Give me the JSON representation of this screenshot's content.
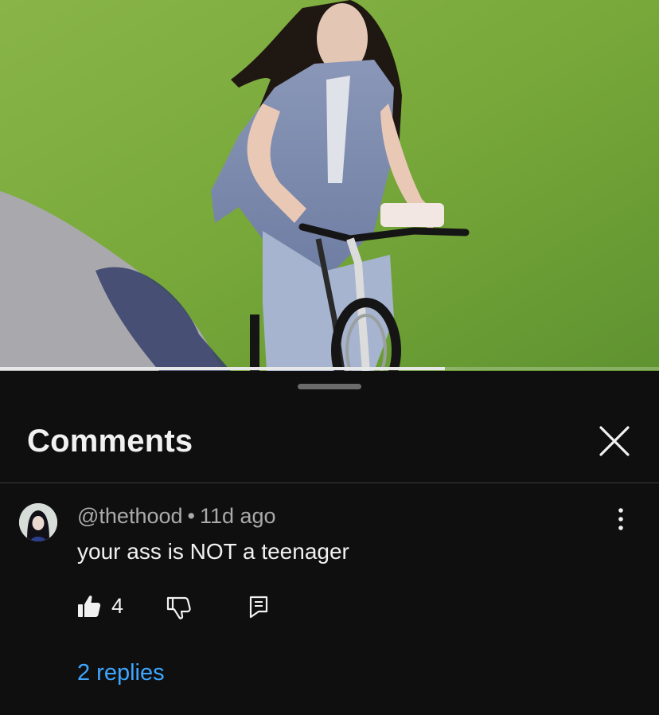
{
  "video": {
    "progress_fraction": 0.675
  },
  "comments_sheet": {
    "title": "Comments",
    "close_icon": "close-icon"
  },
  "comment": {
    "author": "@thethood",
    "separator": "•",
    "time": "11d ago",
    "text": "your ass is NOT a teenager",
    "like_count": "4",
    "replies_label": "2 replies",
    "icons": {
      "like": "thumbs-up-icon",
      "dislike": "thumbs-down-icon",
      "reply": "reply-icon",
      "more": "more-vertical-icon"
    }
  },
  "colors": {
    "background": "#0f0f0f",
    "text_primary": "#f1f1f1",
    "text_secondary": "#aaaaaa",
    "link": "#3ea6ff",
    "divider": "#3a3a3a"
  }
}
